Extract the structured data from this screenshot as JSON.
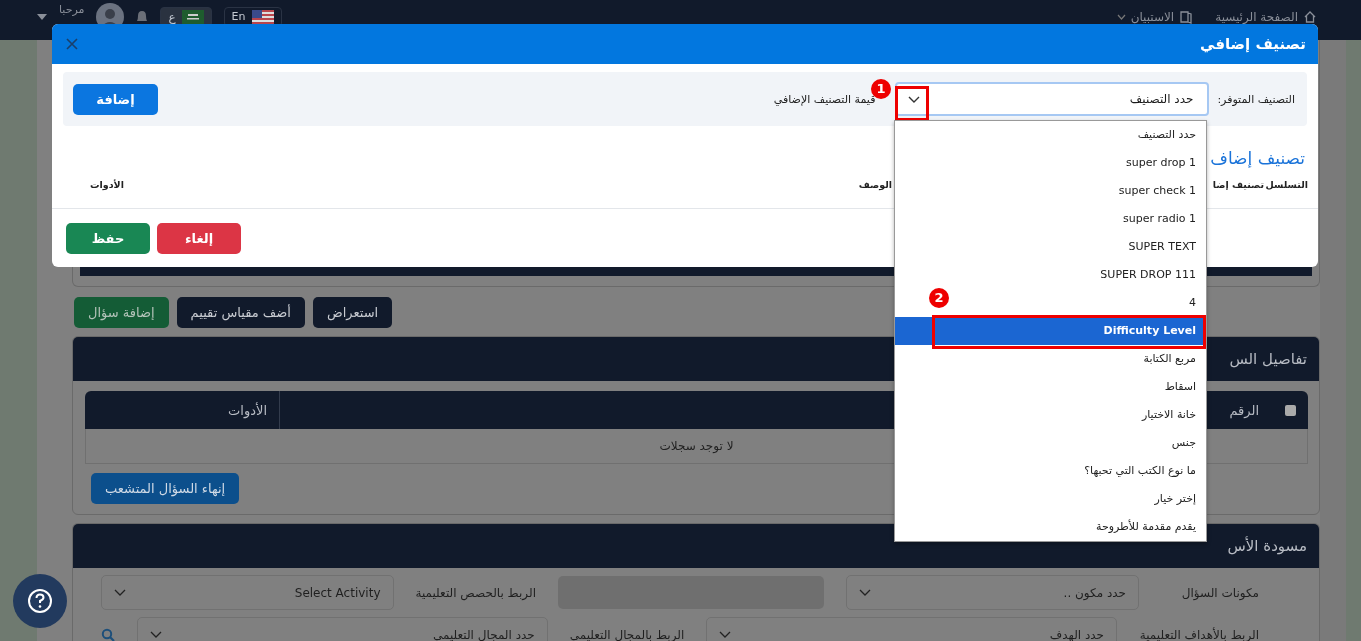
{
  "top_nav": {
    "links": [
      {
        "label": "الصفحة الرئيسية",
        "kind": "home"
      },
      {
        "label": "الاستبيان",
        "kind": "book"
      }
    ],
    "user": {
      "greeting": "مرحبا"
    },
    "languages": [
      {
        "label": "En",
        "kind": "english",
        "selected": false
      },
      {
        "label": "ع",
        "kind": "arabic",
        "selected": true
      }
    ]
  },
  "page": {
    "action_buttons": [
      {
        "label": "استعراض",
        "kind": "dark"
      },
      {
        "label": "أضف مقياس تقييم",
        "kind": "dark"
      },
      {
        "label": "إضافة سؤال",
        "kind": "success"
      }
    ],
    "details_card": {
      "title": "تفاصيل الس",
      "table": {
        "select_all_checked": false,
        "columns": [
          {
            "label": "الرقم",
            "kind": "number"
          },
          {
            "label": "الأدوات",
            "kind": "tools"
          }
        ],
        "empty_text": "لا توجد سجلات"
      },
      "end_button": "إنهاء السؤال المتشعب"
    },
    "draft_card": {
      "title": "مسودة الأس",
      "rows": [
        [
          {
            "kind": "label",
            "text": "مكونات السؤال"
          },
          {
            "kind": "select",
            "value": "حدد مكون .."
          },
          {
            "kind": "disabled"
          },
          {
            "kind": "label",
            "text": "الربط بالحصص التعليمية"
          },
          {
            "kind": "select",
            "value": "Select Activity"
          }
        ],
        [
          {
            "kind": "label",
            "text": "الربط بالأهداف التعليمية"
          },
          {
            "kind": "select",
            "value": "حدد الهدف"
          },
          {
            "kind": "label",
            "text": "الربط بالمجال التعليمي"
          },
          {
            "kind": "select",
            "value": "حدد المجال التعليمي"
          },
          {
            "kind": "search"
          }
        ]
      ]
    }
  },
  "modal": {
    "title": "تصنيف إضافي",
    "filter": {
      "available_label": "التصنيف المتوفر:",
      "select_value": "حدد التصنيف",
      "toggle_annotation": "1",
      "value_label": "قيمة التصنيف الإضافي",
      "add_button": "إضافة"
    },
    "heading": "تصنيف إضاف",
    "columns": [
      "التسلسل",
      "تصنيف إضا",
      "الوصف",
      "الأدوات"
    ],
    "buttons": [
      {
        "label": "إلغاء",
        "kind": "danger"
      },
      {
        "label": "حفظ",
        "kind": "success"
      }
    ]
  },
  "dropdown": {
    "options": [
      {
        "label": "حدد التصنيف",
        "selected": false
      },
      {
        "label": "super drop 1",
        "selected": false
      },
      {
        "label": "super check 1",
        "selected": false
      },
      {
        "label": "super radio 1",
        "selected": false
      },
      {
        "label": "SUPER TEXT",
        "selected": false
      },
      {
        "label": "SUPER DROP 111",
        "selected": false
      },
      {
        "label": "4",
        "selected": false
      },
      {
        "label": "Difficulty Level",
        "selected": true,
        "annotation": "2"
      },
      {
        "label": "مربع الكتابة",
        "selected": false
      },
      {
        "label": "اسقاط",
        "selected": false
      },
      {
        "label": "خانة الاختيار",
        "selected": false
      },
      {
        "label": "جنس",
        "selected": false
      },
      {
        "label": "ما نوع الكتب التي تحبها؟",
        "selected": false
      },
      {
        "label": "إختر خيار",
        "selected": false
      },
      {
        "label": "يقدم مقدمة للأطروحة",
        "selected": false
      }
    ]
  }
}
